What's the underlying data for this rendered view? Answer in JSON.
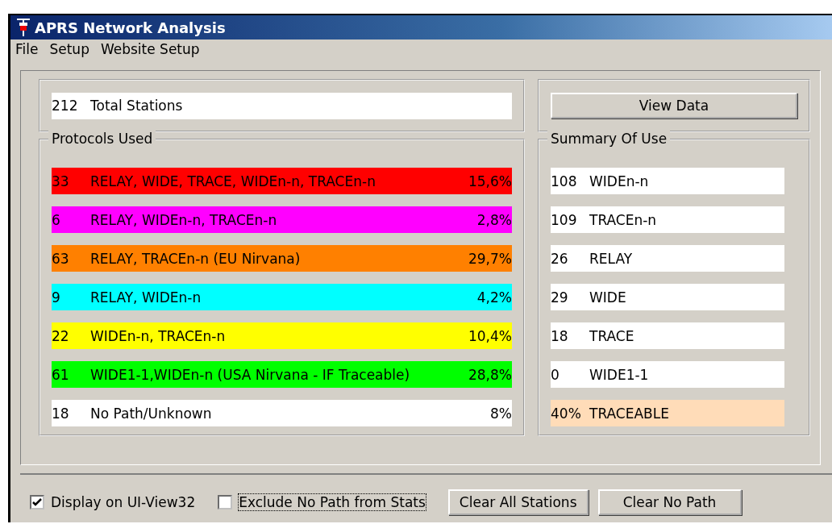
{
  "window": {
    "title": "APRS Network Analysis"
  },
  "menu": [
    "File",
    "Setup",
    "Website Setup"
  ],
  "total": {
    "count": "212",
    "label": "Total Stations"
  },
  "view_button": "View Data",
  "protocols": {
    "title": "Protocols Used",
    "rows": [
      {
        "count": "33",
        "label": "RELAY, WIDE, TRACE, WIDEn-n, TRACEn-n",
        "percent": "15,6%",
        "color": "#ff0000"
      },
      {
        "count": "6",
        "label": "RELAY, WIDEn-n, TRACEn-n",
        "percent": "2,8%",
        "color": "#ff00ff"
      },
      {
        "count": "63",
        "label": "RELAY, TRACEn-n (EU Nirvana)",
        "percent": "29,7%",
        "color": "#ff8000"
      },
      {
        "count": "9",
        "label": "RELAY, WIDEn-n",
        "percent": "4,2%",
        "color": "#00ffff"
      },
      {
        "count": "22",
        "label": "WIDEn-n, TRACEn-n",
        "percent": "10,4%",
        "color": "#ffff00"
      },
      {
        "count": "61",
        "label": "WIDE1-1,WIDEn-n (USA Nirvana - IF Traceable)",
        "percent": "28,8%",
        "color": "#00ff00"
      },
      {
        "count": "18",
        "label": "No Path/Unknown",
        "percent": "8%",
        "color": "#ffffff"
      }
    ]
  },
  "summary": {
    "title": "Summary Of Use",
    "rows": [
      {
        "count": "108",
        "label": "WIDEn-n",
        "color": "#ffffff"
      },
      {
        "count": "109",
        "label": "TRACEn-n",
        "color": "#ffffff"
      },
      {
        "count": "26",
        "label": "RELAY",
        "color": "#ffffff"
      },
      {
        "count": "29",
        "label": "WIDE",
        "color": "#ffffff"
      },
      {
        "count": "18",
        "label": "TRACE",
        "color": "#ffffff"
      },
      {
        "count": "0",
        "label": "WIDE1-1",
        "color": "#ffffff"
      },
      {
        "count": "40%",
        "label": "TRACEABLE",
        "color": "#ffdcb8"
      }
    ]
  },
  "options": [
    {
      "label": "Display on UI-View32",
      "checked": true
    },
    {
      "label": "Exclude No Path from Stats",
      "checked": false
    }
  ],
  "buttons": [
    "Clear All Stations",
    "Clear No Path"
  ]
}
